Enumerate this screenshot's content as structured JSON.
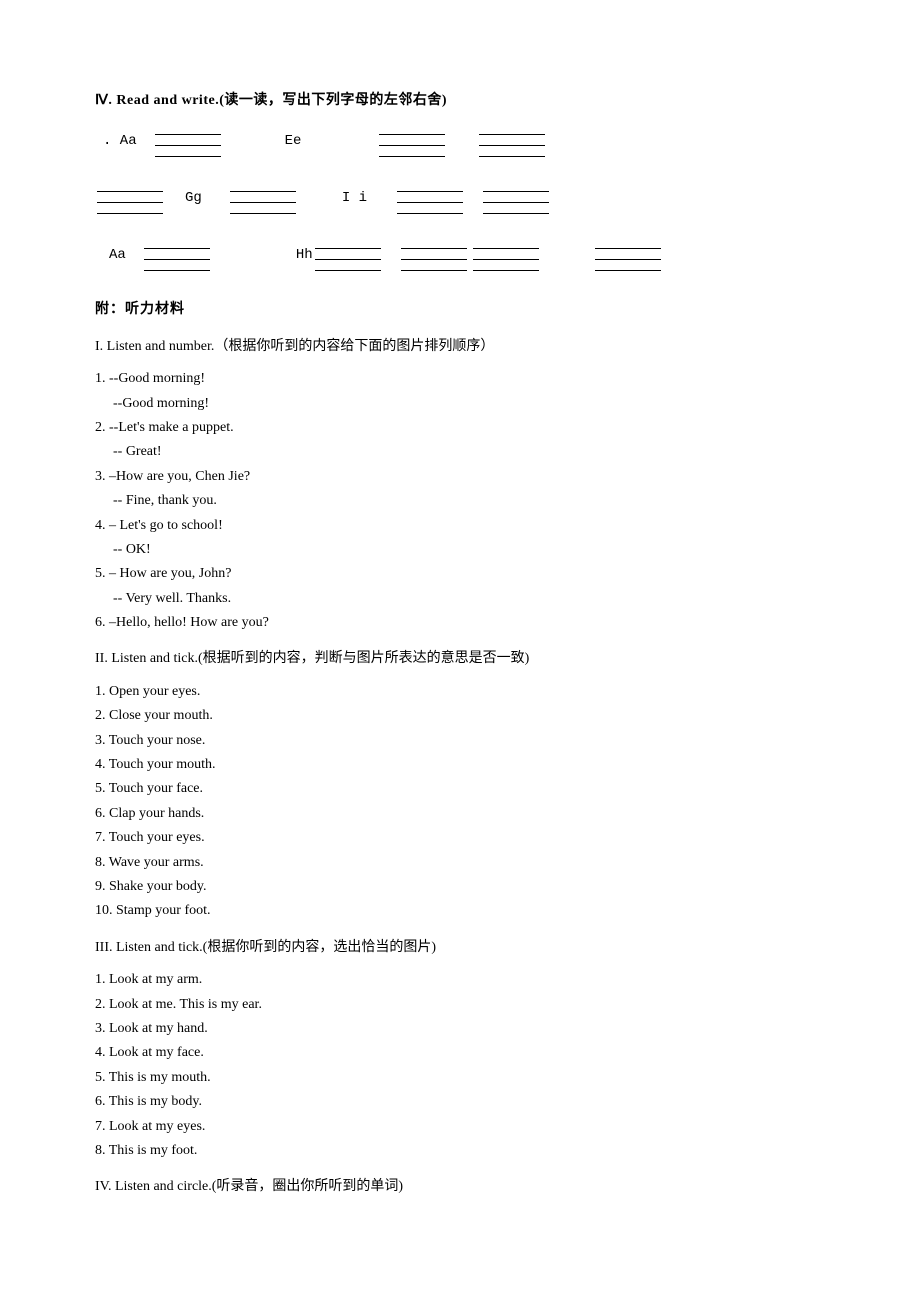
{
  "section4": {
    "title": "Ⅳ. Read and write.(读一读，写出下列字母的左邻右舍)",
    "row1": {
      "label1": ". Aa",
      "mid": "Ee"
    },
    "row2": {
      "mid1": "Gg",
      "mid2": "I i"
    },
    "row3": {
      "label1": "Aa",
      "mid": "Hh"
    }
  },
  "attach": {
    "title": "附：听力材料"
  },
  "s1": {
    "heading": "I. Listen and number.（根据你听到的内容给下面的图片排列顺序）",
    "q1a": "1. --Good morning!",
    "q1b": "--Good morning!",
    "q2a": "2. --Let's make a puppet.",
    "q2b": "-- Great!",
    "q3a": "3. –How are you, Chen Jie?",
    "q3b": "-- Fine, thank you.",
    "q4a": "4. – Let's go to school!",
    "q4b": "-- OK!",
    "q5a": "5. – How are you, John?",
    "q5b": "-- Very well. Thanks.",
    "q6": "6. –Hello, hello! How are you?"
  },
  "s2": {
    "heading": "II. Listen and tick.(根据听到的内容，判断与图片所表达的意思是否一致)",
    "items": [
      "1. Open your eyes.",
      "2. Close your mouth.",
      "3. Touch your nose.",
      "4. Touch your mouth.",
      "5. Touch your face.",
      "6. Clap your hands.",
      "7. Touch your eyes.",
      "8. Wave your arms.",
      "9. Shake your body.",
      "10. Stamp your foot."
    ]
  },
  "s3": {
    "heading": "III. Listen and tick.(根据你听到的内容，选出恰当的图片)",
    "items": [
      "1. Look at my arm.",
      "2. Look at me. This is my ear.",
      "3. Look at my hand.",
      "4. Look at my face.",
      "5. This is my mouth.",
      "6. This is my body.",
      "7. Look at my eyes.",
      "8. This is my foot."
    ]
  },
  "s4": {
    "heading": "IV. Listen and circle.(听录音，圈出你所听到的单词)"
  }
}
